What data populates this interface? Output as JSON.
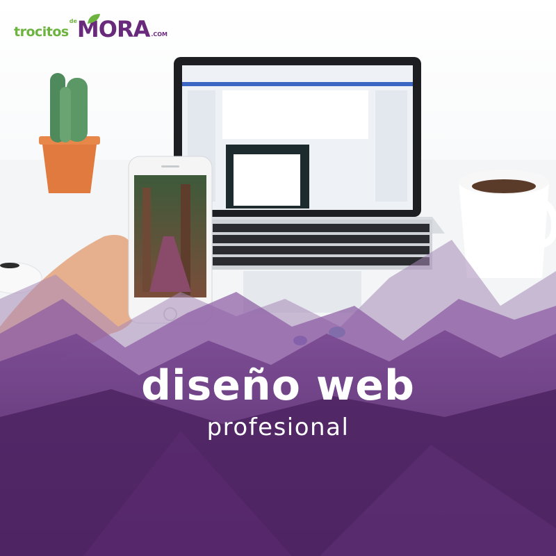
{
  "logo": {
    "part1": "trocitos",
    "part2": "de",
    "part3": "MORA",
    "part4": ".COM",
    "color_green": "#6db33f",
    "color_purple": "#6a2a7c"
  },
  "headline": "diseño web",
  "subheadline": "profesional",
  "colors": {
    "overlay_dark": "#5a2a6e",
    "overlay_mid": "#7b4a90",
    "overlay_light": "#9d76b0",
    "background": "#f4f6f8"
  }
}
